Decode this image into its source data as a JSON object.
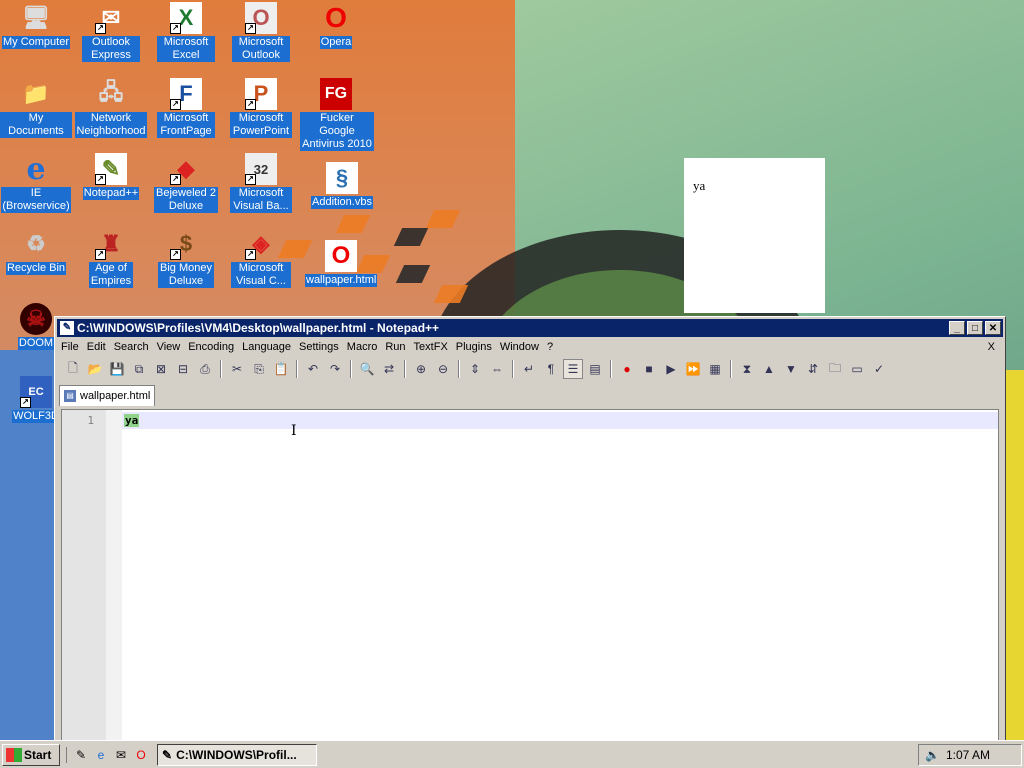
{
  "desktop": {
    "icons": [
      {
        "label": "My Computer",
        "glyph": "🖥",
        "shortcut": false
      },
      {
        "label": "Outlook Express",
        "glyph": "✉",
        "shortcut": true
      },
      {
        "label": "Microsoft Excel",
        "glyph": "X",
        "shortcut": true
      },
      {
        "label": "Microsoft Outlook",
        "glyph": "O",
        "shortcut": true
      },
      {
        "label": "Opera",
        "glyph": "O",
        "shortcut": false
      },
      {
        "label": "My Documents",
        "glyph": "📁",
        "shortcut": false
      },
      {
        "label": "Network Neighborhood",
        "glyph": "🖧",
        "shortcut": false
      },
      {
        "label": "Microsoft FrontPage",
        "glyph": "F",
        "shortcut": true
      },
      {
        "label": "Microsoft PowerPoint",
        "glyph": "P",
        "shortcut": true
      },
      {
        "label": "Fucker Google Antivirus 2010",
        "glyph": "FG",
        "shortcut": false
      },
      {
        "label": "IE (Browservice)",
        "glyph": "e",
        "shortcut": false
      },
      {
        "label": "Notepad++",
        "glyph": "✎",
        "shortcut": true
      },
      {
        "label": "Bejeweled 2 Deluxe",
        "glyph": "◆",
        "shortcut": true
      },
      {
        "label": "Microsoft Visual Ba...",
        "glyph": "32",
        "shortcut": true
      },
      {
        "label": "Addition.vbs",
        "glyph": "§",
        "shortcut": false
      },
      {
        "label": "Recycle Bin",
        "glyph": "♻",
        "shortcut": false
      },
      {
        "label": "Age of Empires",
        "glyph": "♜",
        "shortcut": true
      },
      {
        "label": "Big Money Deluxe",
        "glyph": "$",
        "shortcut": true
      },
      {
        "label": "Microsoft Visual C...",
        "glyph": "◈",
        "shortcut": true
      },
      {
        "label": "wallpaper.html",
        "glyph": "O",
        "shortcut": false
      },
      {
        "label": "DOOM",
        "glyph": "☠",
        "shortcut": false
      },
      {
        "label": "WOLF3D",
        "glyph": "EC",
        "shortcut": true
      }
    ]
  },
  "popup": {
    "text": "ya"
  },
  "notepad": {
    "title": "C:\\WINDOWS\\Profiles\\VM4\\Desktop\\wallpaper.html - Notepad++",
    "menu": [
      "File",
      "Edit",
      "Search",
      "View",
      "Encoding",
      "Language",
      "Settings",
      "Macro",
      "Run",
      "TextFX",
      "Plugins",
      "Window",
      "?"
    ],
    "menu_close": "X",
    "tab_label": "wallpaper.html",
    "line_number": "1",
    "content": "ya"
  },
  "taskbar": {
    "start_label": "Start",
    "task_label": "C:\\WINDOWS\\Profil...",
    "clock": "1:07 AM"
  },
  "colors": {
    "titlebar": "#0a246a",
    "selection": "#1c6fd0",
    "highlight": "#8fd48a"
  }
}
